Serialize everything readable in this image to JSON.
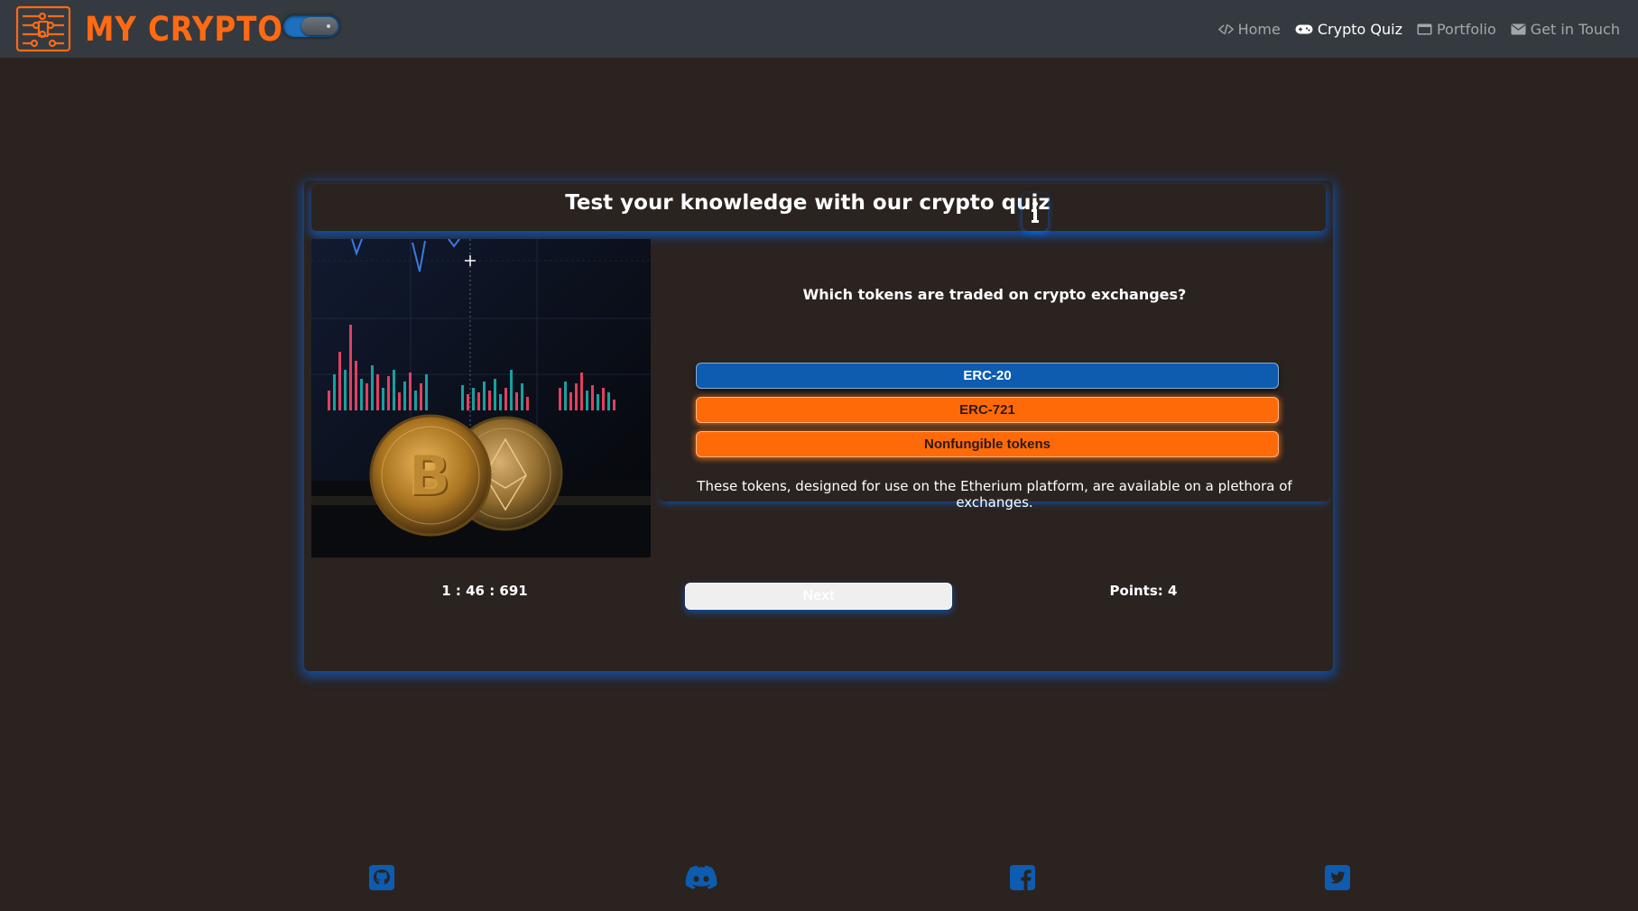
{
  "brand": {
    "name": "MY CRYPTO"
  },
  "colors": {
    "accent": "#ff6a13",
    "navbar_bg": "#343a40",
    "page_bg": "#2b2320",
    "correct": "#0d5cb0",
    "wrong": "#ff6a08",
    "glow": "#0066ff"
  },
  "theme_toggle": {
    "state": "on"
  },
  "nav": {
    "items": [
      {
        "label": "Home",
        "icon": "code-icon",
        "active": false
      },
      {
        "label": "Crypto Quiz",
        "icon": "gamepad-icon",
        "active": true
      },
      {
        "label": "Portfolio",
        "icon": "window-icon",
        "active": false
      },
      {
        "label": "Get in Touch",
        "icon": "envelope-icon",
        "active": false
      }
    ]
  },
  "quiz": {
    "title": "Test your knowledge with our crypto quiz",
    "info_icon": "info-icon",
    "image_icon": "bitcoin-ethereum-coins-chart-photo",
    "question": "Which tokens are traded on crypto exchanges?",
    "answers": [
      {
        "label": "ERC-20",
        "status": "correct"
      },
      {
        "label": "ERC-721",
        "status": "wrong"
      },
      {
        "label": "Nonfungible tokens",
        "status": "wrong"
      }
    ],
    "explanation": "These tokens, designed for use on the Etherium platform, are available on a plethora of exchanges.",
    "timer": "1 : 46 : 691",
    "next_label": "Next",
    "points": "Points: 4"
  },
  "footer": {
    "social": [
      "github-icon",
      "discord-icon",
      "facebook-icon",
      "twitter-icon"
    ]
  }
}
